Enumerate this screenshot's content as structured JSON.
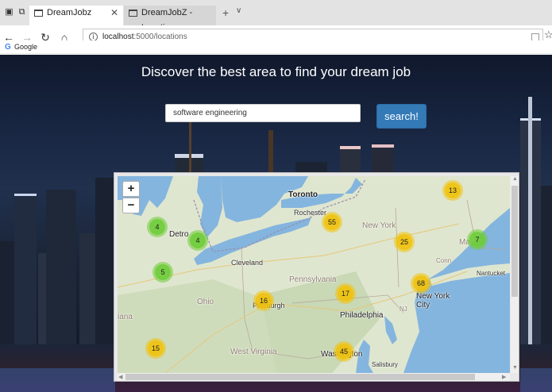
{
  "browser": {
    "tabs": [
      {
        "title": "DreamJobz",
        "close": "✕"
      },
      {
        "title": "DreamJobZ - Locations"
      }
    ],
    "new_tab": "+",
    "tab_menu": "∨",
    "address": {
      "host": "localhost",
      "path": ":5000/locations"
    },
    "favorites": [
      {
        "label": "Google",
        "icon": "G"
      }
    ]
  },
  "page": {
    "headline": "Discover the best area to find your dream job",
    "search_value": "software engineering",
    "search_button": "search!"
  },
  "map": {
    "zoom_in": "+",
    "zoom_out": "−",
    "places": {
      "toronto": "Toronto",
      "rochester": "Rochester",
      "detroit": "Detro",
      "cleveland": "Cleveland",
      "pennsylvania": "Pennsylvania",
      "ohio": "Ohio",
      "pittsburgh": "Pittsburgh",
      "new_york_state": "New York",
      "philadelphia": "Philadelphia",
      "new_york_city": "New York\nCity",
      "nj": "NJ",
      "conn": "Conn",
      "nantucket": "Nantucket",
      "west_virginia": "West Virginia",
      "washington": "Washington",
      "md": "Md",
      "salisbury": "Salisbury",
      "indiana": "iana",
      "mass": "Ma"
    },
    "clusters": [
      {
        "count": "13",
        "size": "medium"
      },
      {
        "count": "4",
        "size": "small"
      },
      {
        "count": "4",
        "size": "small"
      },
      {
        "count": "55",
        "size": "medium"
      },
      {
        "count": "25",
        "size": "medium"
      },
      {
        "count": "7",
        "size": "small"
      },
      {
        "count": "5",
        "size": "small"
      },
      {
        "count": "68",
        "size": "medium"
      },
      {
        "count": "16",
        "size": "medium"
      },
      {
        "count": "17",
        "size": "medium"
      },
      {
        "count": "15",
        "size": "medium"
      },
      {
        "count": "45",
        "size": "medium"
      }
    ]
  }
}
